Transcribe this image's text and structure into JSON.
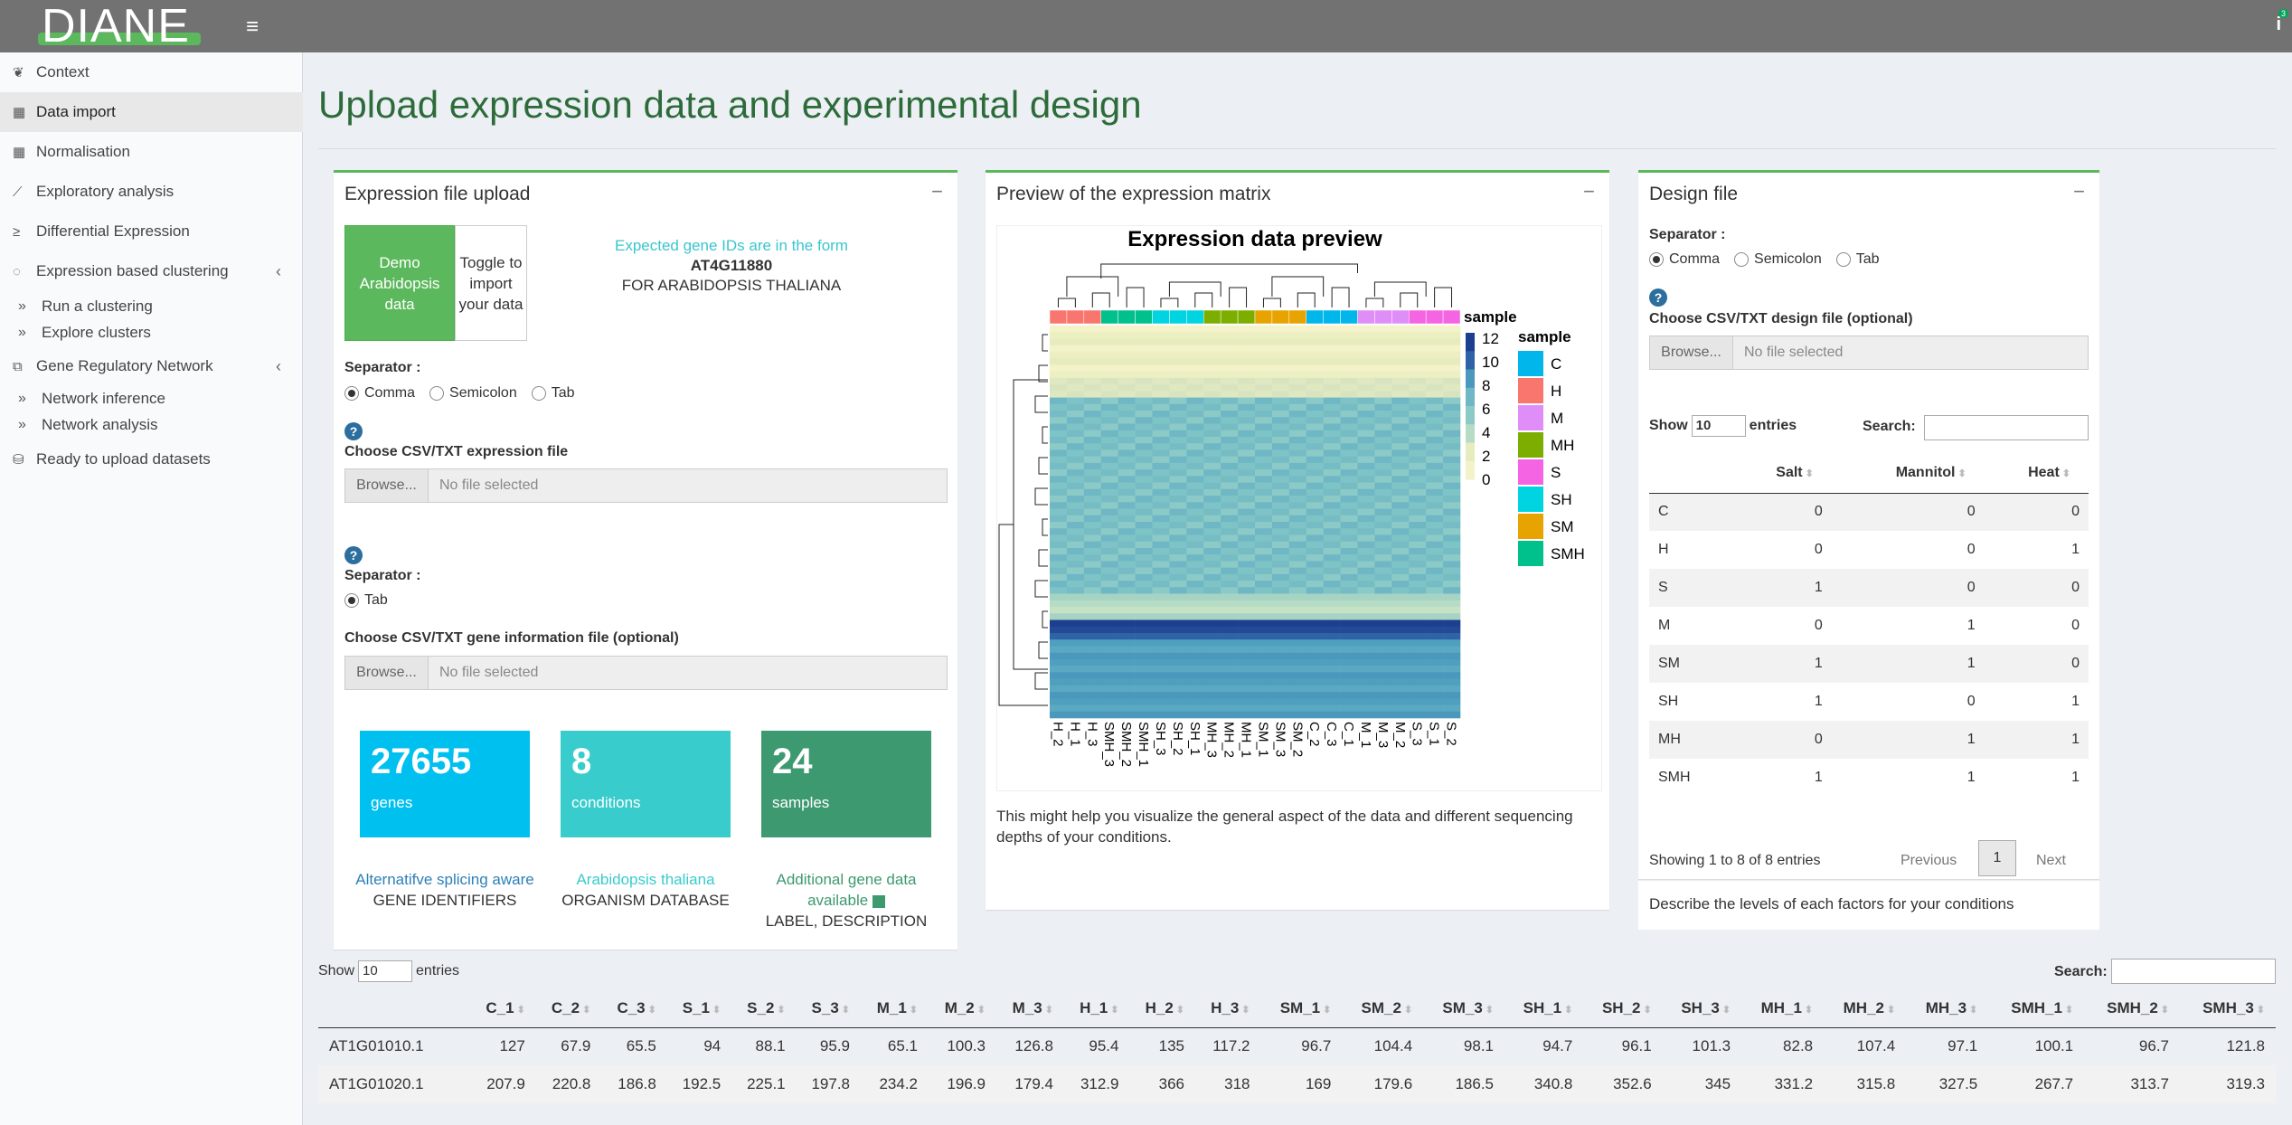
{
  "app": {
    "logo": "DIANE",
    "notification_count": "3"
  },
  "sidebar": {
    "items": [
      {
        "label": "Context",
        "icon": "leaf-icon"
      },
      {
        "label": "Data import",
        "icon": "table-icon"
      },
      {
        "label": "Normalisation",
        "icon": "table-icon"
      },
      {
        "label": "Exploratory analysis",
        "icon": "chart-line-icon"
      },
      {
        "label": "Differential Expression",
        "icon": "greater-equal-icon"
      },
      {
        "label": "Expression based clustering",
        "icon": "circle-notch-icon"
      },
      {
        "label": "Run a clustering",
        "icon": "double-chevron-icon"
      },
      {
        "label": "Explore clusters",
        "icon": "double-chevron-icon"
      },
      {
        "label": "Gene Regulatory Network",
        "icon": "network-icon"
      },
      {
        "label": "Network inference",
        "icon": "double-chevron-icon"
      },
      {
        "label": "Network analysis",
        "icon": "double-chevron-icon"
      },
      {
        "label": "Ready to upload datasets",
        "icon": "database-icon"
      }
    ]
  },
  "page": {
    "title": "Upload expression data and experimental design"
  },
  "upload": {
    "title": "Expression file upload",
    "minus": "−",
    "demo_label": "Demo Arabidopsis data",
    "toggle_label": "Toggle to import your data",
    "gene_form_1": "Expected gene IDs are in the form",
    "gene_form_2": "AT4G11880",
    "gene_form_3": "FOR ARABIDOPSIS THALIANA",
    "separator_label": "Separator :",
    "sep_comma": "Comma",
    "sep_semicolon": "Semicolon",
    "sep_tab": "Tab",
    "choose_expr": "Choose CSV/TXT expression file",
    "browse": "Browse...",
    "no_file": "No file selected",
    "separator2_label": "Separator :",
    "sep2_tab": "Tab",
    "choose_gene_info": "Choose CSV/TXT gene information file (optional)",
    "help": "?",
    "stats": [
      {
        "value": "27655",
        "label": "genes",
        "color": "#00c0ef"
      },
      {
        "value": "8",
        "label": "conditions",
        "color": "#39cccc"
      },
      {
        "value": "24",
        "label": "samples",
        "color": "#3d9970"
      }
    ],
    "cap1_line1": "Alternatifve splicing aware",
    "cap1_line2": "GENE IDENTIFIERS",
    "cap2_line1": "Arabidopsis thaliana",
    "cap2_line2": "ORGANISM DATABASE",
    "cap3_line1": "Additional gene data available",
    "cap3_line2": "LABEL, DESCRIPTION"
  },
  "preview": {
    "title": "Preview of the expression matrix",
    "minus": "−",
    "note": "This might help you visualize the general aspect of the data and different sequencing depths of your conditions."
  },
  "chart_data": {
    "type": "heatmap",
    "title": "Expression data preview",
    "x_labels": [
      "H_2",
      "H_1",
      "H_3",
      "SMH_3",
      "SMH_2",
      "SMH_1",
      "SH_3",
      "SH_2",
      "SH_1",
      "MH_3",
      "MH_2",
      "MH_1",
      "SM_1",
      "SM_3",
      "SM_2",
      "C_2",
      "C_3",
      "C_1",
      "M_1",
      "M_3",
      "M_2",
      "S_3",
      "S_1",
      "S_2"
    ],
    "annotation_track": "sample",
    "colorbar_label": "sample",
    "colorbar_ticks": [
      "12",
      "10",
      "8",
      "6",
      "4",
      "2",
      "0"
    ],
    "legend_title": "sample",
    "legend": [
      {
        "name": "C",
        "color": "#00b6eb"
      },
      {
        "name": "H",
        "color": "#f8766d"
      },
      {
        "name": "M",
        "color": "#e08ef7"
      },
      {
        "name": "MH",
        "color": "#7cae00"
      },
      {
        "name": "S",
        "color": "#f564e3"
      },
      {
        "name": "SH",
        "color": "#00d4e0"
      },
      {
        "name": "SM",
        "color": "#e7a300"
      },
      {
        "name": "SMH",
        "color": "#00c08b"
      }
    ],
    "sample_groups": [
      "H",
      "H",
      "H",
      "SMH",
      "SMH",
      "SMH",
      "SH",
      "SH",
      "SH",
      "MH",
      "MH",
      "MH",
      "SM",
      "SM",
      "SM",
      "C",
      "C",
      "C",
      "M",
      "M",
      "M",
      "S",
      "S",
      "S"
    ]
  },
  "design": {
    "title": "Design file",
    "minus": "−",
    "separator_label": "Separator :",
    "sep_comma": "Comma",
    "sep_semicolon": "Semicolon",
    "sep_tab": "Tab",
    "help": "?",
    "choose": "Choose CSV/TXT design file (optional)",
    "browse": "Browse...",
    "no_file": "No file selected",
    "show": "Show",
    "entries_value": "10",
    "entries": "entries",
    "search": "Search:",
    "columns": [
      "",
      "Salt",
      "Mannitol",
      "Heat"
    ],
    "rows": [
      [
        "C",
        "0",
        "0",
        "0"
      ],
      [
        "H",
        "0",
        "0",
        "1"
      ],
      [
        "S",
        "1",
        "0",
        "0"
      ],
      [
        "M",
        "0",
        "1",
        "0"
      ],
      [
        "SM",
        "1",
        "1",
        "0"
      ],
      [
        "SH",
        "1",
        "0",
        "1"
      ],
      [
        "MH",
        "0",
        "1",
        "1"
      ],
      [
        "SMH",
        "1",
        "1",
        "1"
      ]
    ],
    "info": "Showing 1 to 8 of 8 entries",
    "prev": "Previous",
    "page": "1",
    "next": "Next",
    "footer": "Describe the levels of each factors for your conditions"
  },
  "expr_table": {
    "show": "Show",
    "entries_value": "10",
    "entries": "entries",
    "search": "Search:",
    "columns": [
      "",
      "C_1",
      "C_2",
      "C_3",
      "S_1",
      "S_2",
      "S_3",
      "M_1",
      "M_2",
      "M_3",
      "H_1",
      "H_2",
      "H_3",
      "SM_1",
      "SM_2",
      "SM_3",
      "SH_1",
      "SH_2",
      "SH_3",
      "MH_1",
      "MH_2",
      "MH_3",
      "SMH_1",
      "SMH_2",
      "SMH_3"
    ],
    "rows": [
      [
        "AT1G01010.1",
        "127",
        "67.9",
        "65.5",
        "94",
        "88.1",
        "95.9",
        "65.1",
        "100.3",
        "126.8",
        "95.4",
        "135",
        "117.2",
        "96.7",
        "104.4",
        "98.1",
        "94.7",
        "96.1",
        "101.3",
        "82.8",
        "107.4",
        "97.1",
        "100.1",
        "96.7",
        "121.8"
      ],
      [
        "AT1G01020.1",
        "207.9",
        "220.8",
        "186.8",
        "192.5",
        "225.1",
        "197.8",
        "234.2",
        "196.9",
        "179.4",
        "312.9",
        "366",
        "318",
        "169",
        "179.6",
        "186.5",
        "340.8",
        "352.6",
        "345",
        "331.2",
        "315.8",
        "327.5",
        "267.7",
        "313.7",
        "319.3"
      ]
    ]
  }
}
